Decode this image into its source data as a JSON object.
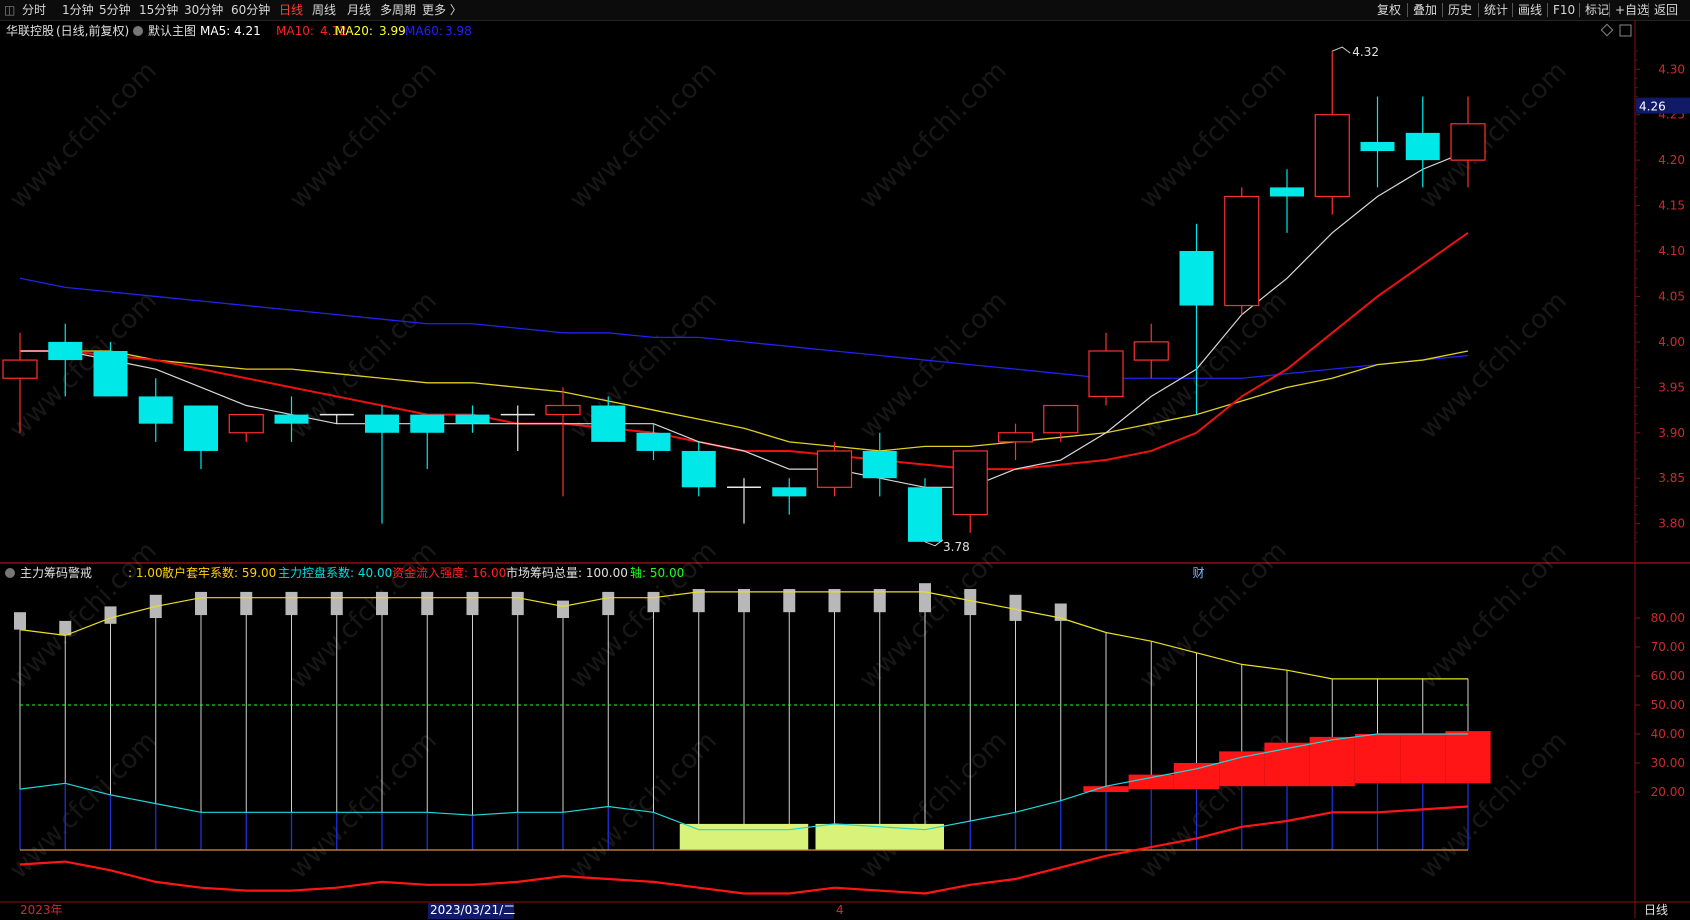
{
  "toolbar": {
    "left_items": [
      "分时",
      "1分钟",
      "5分钟",
      "15分钟",
      "30分钟",
      "60分钟",
      "日线",
      "周线",
      "月线",
      "多周期",
      "更多 〉"
    ],
    "active_item": "日线",
    "right_items": [
      "复权",
      "叠加",
      "历史",
      "统计",
      "画线",
      "F10",
      "标记",
      "+自选",
      "返回"
    ]
  },
  "main_panel": {
    "stock_name": "华联控股",
    "adjust_mode": "(日线,前复权)",
    "indicator_name": "默认主图",
    "ma": [
      {
        "label": "MA5:",
        "value": "4.21",
        "color": "#ffffff"
      },
      {
        "label": "MA10:",
        "value": "4.12",
        "color": "#ff2020"
      },
      {
        "label": "MA20:",
        "value": "3.99",
        "color": "#ffff30"
      },
      {
        "label": "MA60:",
        "value": "3.98",
        "color": "#2020ff"
      }
    ],
    "price_axis": [
      "4.30",
      "4.25",
      "4.20",
      "4.15",
      "4.10",
      "4.05",
      "4.00",
      "3.95",
      "3.90",
      "3.85",
      "3.80"
    ],
    "current_price": "4.26",
    "high_label": "4.32",
    "low_label": "3.78",
    "cai_marker": "财"
  },
  "sub_panel": {
    "title": "主力筹码警戒",
    "params": [
      {
        "label": ": 1.00",
        "color": "#ffd000"
      },
      {
        "label": "散户套牢系数: 59.00",
        "color": "#ffd000"
      },
      {
        "label": "主力控盘系数: 40.00",
        "color": "#00e0e0"
      },
      {
        "label": "资金流入强度: 16.00",
        "color": "#ff2020"
      },
      {
        "label": "市场筹码总量: 100.00",
        "color": "#e0e0e0"
      },
      {
        "label": "轴: 50.00",
        "color": "#20ff20"
      }
    ],
    "axis": [
      "80.00",
      "70.00",
      "60.00",
      "50.00",
      "40.00",
      "30.00",
      "20.00"
    ]
  },
  "bottom_bar": {
    "labels": [
      "2023年",
      "2023/03/21/二",
      "4"
    ],
    "period": "日线"
  },
  "watermark": "www.cfchi.com",
  "chart_data": {
    "type": "candlestick",
    "ylim": [
      3.76,
      4.33
    ],
    "candles": [
      {
        "o": 3.96,
        "h": 4.01,
        "l": 3.9,
        "c": 3.98
      },
      {
        "o": 4.0,
        "h": 4.02,
        "l": 3.94,
        "c": 3.98
      },
      {
        "o": 3.99,
        "h": 4.0,
        "l": 3.94,
        "c": 3.94
      },
      {
        "o": 3.94,
        "h": 3.96,
        "l": 3.89,
        "c": 3.91
      },
      {
        "o": 3.93,
        "h": 3.93,
        "l": 3.86,
        "c": 3.88
      },
      {
        "o": 3.9,
        "h": 3.92,
        "l": 3.89,
        "c": 3.92
      },
      {
        "o": 3.92,
        "h": 3.94,
        "l": 3.89,
        "c": 3.91
      },
      {
        "o": 3.92,
        "h": 3.92,
        "l": 3.91,
        "c": 3.92
      },
      {
        "o": 3.92,
        "h": 3.93,
        "l": 3.8,
        "c": 3.9
      },
      {
        "o": 3.92,
        "h": 3.92,
        "l": 3.86,
        "c": 3.9
      },
      {
        "o": 3.92,
        "h": 3.93,
        "l": 3.9,
        "c": 3.91
      },
      {
        "o": 3.92,
        "h": 3.93,
        "l": 3.88,
        "c": 3.92
      },
      {
        "o": 3.92,
        "h": 3.95,
        "l": 3.83,
        "c": 3.93
      },
      {
        "o": 3.93,
        "h": 3.94,
        "l": 3.89,
        "c": 3.89
      },
      {
        "o": 3.9,
        "h": 3.91,
        "l": 3.87,
        "c": 3.88
      },
      {
        "o": 3.88,
        "h": 3.89,
        "l": 3.83,
        "c": 3.84
      },
      {
        "o": 3.84,
        "h": 3.85,
        "l": 3.8,
        "c": 3.84
      },
      {
        "o": 3.84,
        "h": 3.85,
        "l": 3.81,
        "c": 3.83
      },
      {
        "o": 3.84,
        "h": 3.89,
        "l": 3.83,
        "c": 3.88
      },
      {
        "o": 3.88,
        "h": 3.9,
        "l": 3.83,
        "c": 3.85
      },
      {
        "o": 3.84,
        "h": 3.85,
        "l": 3.78,
        "c": 3.78
      },
      {
        "o": 3.81,
        "h": 3.87,
        "l": 3.79,
        "c": 3.88
      },
      {
        "o": 3.89,
        "h": 3.91,
        "l": 3.87,
        "c": 3.9
      },
      {
        "o": 3.9,
        "h": 3.93,
        "l": 3.89,
        "c": 3.93
      },
      {
        "o": 3.94,
        "h": 4.01,
        "l": 3.93,
        "c": 3.99
      },
      {
        "o": 3.98,
        "h": 4.02,
        "l": 3.96,
        "c": 4.0
      },
      {
        "o": 4.1,
        "h": 4.13,
        "l": 3.92,
        "c": 4.04
      },
      {
        "o": 4.04,
        "h": 4.17,
        "l": 4.03,
        "c": 4.16
      },
      {
        "o": 4.17,
        "h": 4.19,
        "l": 4.12,
        "c": 4.16
      },
      {
        "o": 4.16,
        "h": 4.32,
        "l": 4.14,
        "c": 4.25
      },
      {
        "o": 4.22,
        "h": 4.27,
        "l": 4.17,
        "c": 4.21
      },
      {
        "o": 4.23,
        "h": 4.27,
        "l": 4.17,
        "c": 4.2
      },
      {
        "o": 4.2,
        "h": 4.27,
        "l": 4.17,
        "c": 4.24
      }
    ],
    "ma5": [
      3.99,
      3.99,
      3.98,
      3.97,
      3.95,
      3.93,
      3.92,
      3.91,
      3.91,
      3.91,
      3.91,
      3.91,
      3.91,
      3.91,
      3.91,
      3.89,
      3.88,
      3.86,
      3.86,
      3.85,
      3.84,
      3.84,
      3.86,
      3.87,
      3.9,
      3.94,
      3.97,
      4.03,
      4.07,
      4.12,
      4.16,
      4.19,
      4.21
    ],
    "ma10": [
      3.99,
      3.99,
      3.985,
      3.98,
      3.97,
      3.96,
      3.95,
      3.94,
      3.93,
      3.92,
      3.92,
      3.91,
      3.91,
      3.905,
      3.9,
      3.89,
      3.88,
      3.88,
      3.875,
      3.87,
      3.865,
      3.86,
      3.86,
      3.865,
      3.87,
      3.88,
      3.9,
      3.94,
      3.97,
      4.01,
      4.05,
      4.085,
      4.12
    ],
    "ma20": [
      3.99,
      3.99,
      3.99,
      3.98,
      3.975,
      3.97,
      3.97,
      3.965,
      3.96,
      3.955,
      3.955,
      3.95,
      3.945,
      3.935,
      3.925,
      3.915,
      3.905,
      3.89,
      3.885,
      3.88,
      3.885,
      3.885,
      3.89,
      3.895,
      3.9,
      3.91,
      3.92,
      3.935,
      3.95,
      3.96,
      3.975,
      3.98,
      3.99
    ],
    "ma60": [
      4.07,
      4.06,
      4.055,
      4.05,
      4.045,
      4.04,
      4.035,
      4.03,
      4.025,
      4.02,
      4.02,
      4.015,
      4.01,
      4.01,
      4.005,
      4.005,
      4.0,
      3.995,
      3.99,
      3.985,
      3.98,
      3.975,
      3.97,
      3.965,
      3.96,
      3.96,
      3.96,
      3.96,
      3.965,
      3.97,
      3.975,
      3.98,
      3.985
    ],
    "sub_ylim": [
      0,
      100
    ],
    "sub_yellow": [
      76,
      74,
      80,
      84,
      87,
      87,
      87,
      87,
      87,
      87,
      87,
      87,
      84,
      87,
      87,
      89,
      89,
      89,
      89,
      89,
      89,
      86,
      83,
      80,
      75,
      72,
      68,
      64,
      62,
      59,
      59,
      59,
      59
    ],
    "sub_gray_top": [
      82,
      79,
      84,
      88,
      89,
      89,
      89,
      89,
      89,
      89,
      89,
      89,
      86,
      89,
      89,
      90,
      90,
      90,
      90,
      90,
      92,
      90,
      88,
      85
    ],
    "sub_gray_bot": [
      76,
      74,
      78,
      80,
      81,
      81,
      81,
      81,
      81,
      81,
      81,
      81,
      80,
      81,
      82,
      82,
      82,
      82,
      82,
      82,
      82,
      81,
      79,
      79
    ],
    "sub_cyan": [
      21,
      23,
      19,
      16,
      13,
      13,
      13,
      13,
      13,
      13,
      12,
      13,
      13,
      15,
      13,
      7,
      7,
      7,
      9,
      8,
      7,
      10,
      13,
      17,
      22,
      25,
      28,
      32,
      35,
      38,
      40,
      40,
      40
    ],
    "sub_red_bottom": [
      -5,
      -4,
      -7,
      -11,
      -13,
      -14,
      -14,
      -13,
      -11,
      -12,
      -12,
      -11,
      -9,
      -10,
      -11,
      -13,
      -15,
      -15,
      -13,
      -14,
      -15,
      -12,
      -10,
      -6,
      -2,
      1,
      4,
      8,
      10,
      13,
      13,
      14,
      15
    ],
    "sub_red_bar_top": [
      null,
      null,
      null,
      null,
      null,
      null,
      null,
      null,
      null,
      null,
      null,
      null,
      null,
      null,
      null,
      null,
      null,
      null,
      null,
      null,
      null,
      null,
      null,
      null,
      22,
      26,
      30,
      34,
      37,
      39,
      40,
      40,
      41
    ],
    "sub_red_bar_bot": [
      null,
      null,
      null,
      null,
      null,
      null,
      null,
      null,
      null,
      null,
      null,
      null,
      null,
      null,
      null,
      null,
      null,
      null,
      null,
      null,
      null,
      null,
      null,
      null,
      20,
      21,
      21,
      22,
      22,
      22,
      23,
      23,
      23
    ],
    "sub_green_blocks": [
      [
        15,
        17
      ],
      [
        18,
        20
      ]
    ]
  }
}
